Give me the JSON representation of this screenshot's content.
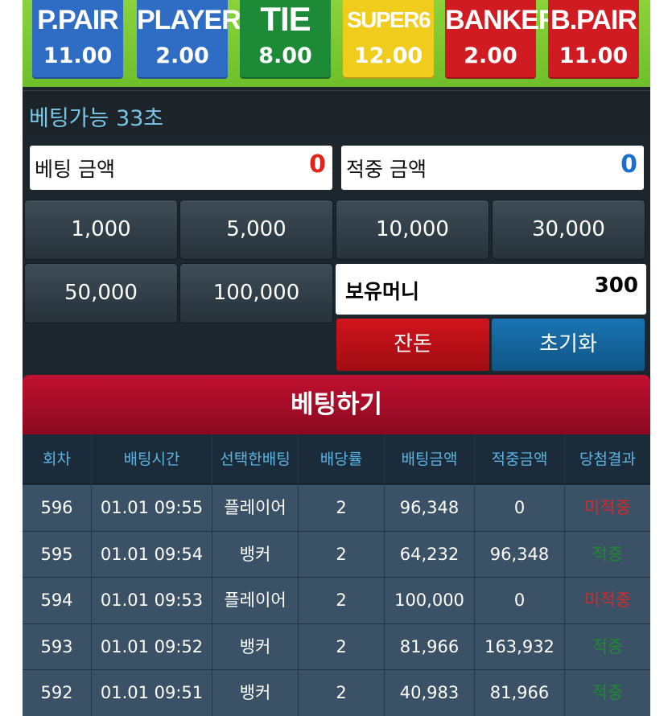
{
  "odds": [
    {
      "name": "P.PAIR",
      "value": "11.00",
      "color": "#2f6cc4"
    },
    {
      "name": "PLAYER",
      "value": "2.00",
      "color": "#2f6cc4"
    },
    {
      "name": "TIE",
      "value": "8.00",
      "color": "#1d8a38"
    },
    {
      "name": "SUPER6",
      "value": "12.00",
      "color": "#f0cc1c"
    },
    {
      "name": "BANKER",
      "value": "2.00",
      "color": "#d01b22"
    },
    {
      "name": "B.PAIR",
      "value": "11.00",
      "color": "#d01b22"
    }
  ],
  "status": {
    "text": "베팅가능 33초"
  },
  "bet_amount": {
    "label": "베팅 금액",
    "value": "0",
    "color": "#e2231a"
  },
  "win_amount": {
    "label": "적중 금액",
    "value": "0",
    "color": "#1a6fd1"
  },
  "chips": [
    "1,000",
    "5,000",
    "10,000",
    "30,000",
    "50,000",
    "100,000"
  ],
  "holdings": {
    "label": "보유머니",
    "value": "300"
  },
  "actions": {
    "change_label": "잔돈",
    "reset_label": "초기화"
  },
  "bet_button": {
    "label": "베팅하기"
  },
  "table": {
    "headers": [
      "회차",
      "배팅시간",
      "선택한배팅",
      "배당률",
      "배팅금액",
      "적중금액",
      "당첨결과"
    ],
    "rows": [
      {
        "round": "596",
        "time": "01.01 09:55",
        "pick": "플레이어",
        "odds": "2",
        "bet": "96,348",
        "win": "0",
        "result": "미적중",
        "outcome": "lose"
      },
      {
        "round": "595",
        "time": "01.01 09:54",
        "pick": "뱅커",
        "odds": "2",
        "bet": "64,232",
        "win": "96,348",
        "result": "적중",
        "outcome": "win"
      },
      {
        "round": "594",
        "time": "01.01 09:53",
        "pick": "플레이어",
        "odds": "2",
        "bet": "100,000",
        "win": "0",
        "result": "미적중",
        "outcome": "lose"
      },
      {
        "round": "593",
        "time": "01.01 09:52",
        "pick": "뱅커",
        "odds": "2",
        "bet": "81,966",
        "win": "163,932",
        "result": "적중",
        "outcome": "win"
      },
      {
        "round": "592",
        "time": "01.01 09:51",
        "pick": "뱅커",
        "odds": "2",
        "bet": "40,983",
        "win": "81,966",
        "result": "적중",
        "outcome": "win"
      }
    ]
  }
}
